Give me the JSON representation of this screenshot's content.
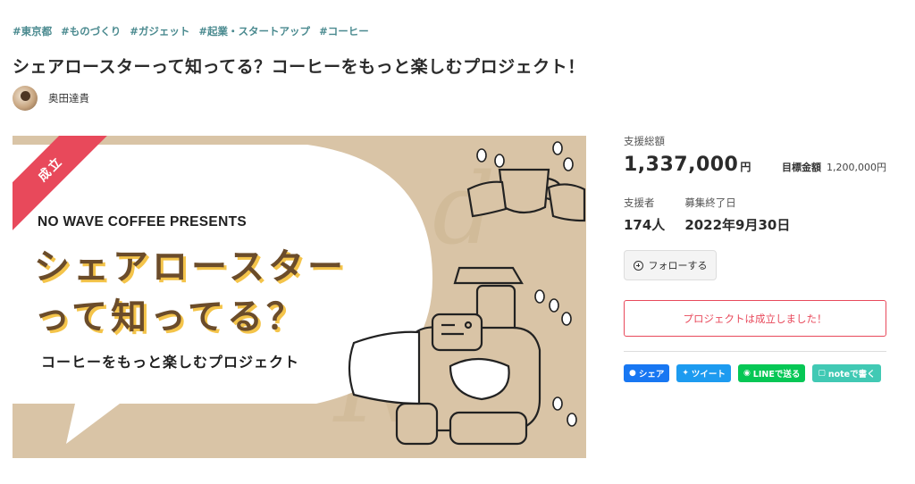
{
  "tags": [
    "#東京都",
    "#ものづくり",
    "#ガジェット",
    "#起業・スタートアップ",
    "#コーヒー"
  ],
  "title": "シェアロースターって知ってる？コーヒーをもっと楽しむプロジェクト！",
  "owner": {
    "name": "奥田達貴"
  },
  "hero": {
    "ribbon": "成立",
    "presents": "NO WAVE COFFEE PRESENTS",
    "headline_line1": "シェアロースター",
    "headline_line2": "って知ってる？",
    "subline": "コーヒーをもっと楽しむプロジェクト"
  },
  "stats": {
    "total_label": "支援総額",
    "total_value": "1,337,000",
    "total_unit": "円",
    "goal_label": "目標金額",
    "goal_value": "1,200,000円",
    "supporters_label": "支援者",
    "supporters_value": "174人",
    "deadline_label": "募集終了日",
    "deadline_value": "2022年9月30日"
  },
  "actions": {
    "follow_label": "フォローする",
    "success_message": "プロジェクトは成立しました！"
  },
  "share": {
    "facebook": "シェア",
    "twitter": "ツイート",
    "line": "LINEで送る",
    "note": "noteで書く"
  },
  "colors": {
    "accent_red": "#e8495b",
    "tag_teal": "#4a8a8f",
    "hero_bg": "#d9c4a6",
    "headline_brown": "#6b4c2a",
    "headline_shadow": "#f4c44a"
  }
}
